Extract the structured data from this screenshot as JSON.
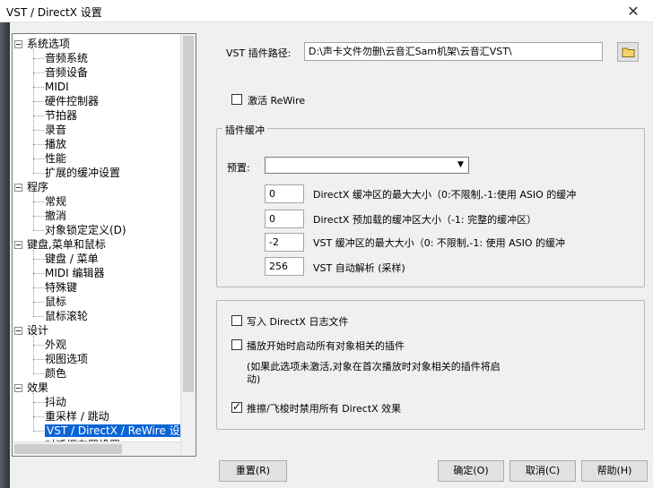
{
  "window": {
    "title": "VST / DirectX 设置",
    "close_glyph": "✕"
  },
  "tree": {
    "groups": [
      {
        "label": "系统选项",
        "children": [
          "音频系统",
          "音频设备",
          "MIDI",
          "硬件控制器",
          "节拍器",
          "录音",
          "播放",
          "性能",
          "扩展的缓冲设置"
        ]
      },
      {
        "label": "程序",
        "children": [
          "常规",
          "撤消",
          "对象锁定定义(D)"
        ]
      },
      {
        "label": "键盘,菜单和鼠标",
        "children": [
          "键盘 / 菜单",
          "MIDI 编辑器",
          "特殊键",
          "鼠标",
          "鼠标滚轮"
        ]
      },
      {
        "label": "设计",
        "children": [
          "外观",
          "视图选项",
          "颜色"
        ]
      },
      {
        "label": "效果",
        "children": [
          "抖动",
          "重采样 / 跳动",
          "VST / DirectX / ReWire 设置"
        ]
      }
    ],
    "partial_item": "对话框布置设置",
    "selected": "VST / DirectX / ReWire 设置"
  },
  "vst_path": {
    "label": "VST 插件路径:",
    "value": "D:\\声卡文件勿删\\云音汇Sam机架\\云音汇VST\\"
  },
  "rewire": {
    "label": "激活 ReWire",
    "checked": false
  },
  "plugin_buffer": {
    "title": "插件缓冲",
    "preset_label": "预置:",
    "preset_value": "",
    "rows": [
      {
        "value": "0",
        "label": "DirectX 缓冲区的最大大小（0:不限制,-1:使用 ASIO 的缓冲"
      },
      {
        "value": "0",
        "label": "DirectX 预加载的缓冲区大小（-1: 完整的缓冲区）"
      },
      {
        "value": "-2",
        "label": "VST 缓冲区的最大大小（0: 不限制,-1: 使用 ASIO 的缓冲"
      },
      {
        "value": "256",
        "label": "VST 自动解析 (采样)"
      }
    ]
  },
  "options": {
    "log": {
      "label": "写入 DirectX 日志文件",
      "checked": false
    },
    "start_plugins": {
      "label": "播放开始时启动所有对象相关的插件",
      "checked": false
    },
    "note": "(如果此选项未激活,对象在首次播放时对象相关的插件将启动)",
    "disable_scrub": {
      "label": "推擦/飞梭时禁用所有 DirectX 效果",
      "checked": true
    }
  },
  "buttons": {
    "reset": "重置(R)",
    "ok": "确定(O)",
    "cancel": "取消(C)",
    "help": "帮助(H)"
  }
}
